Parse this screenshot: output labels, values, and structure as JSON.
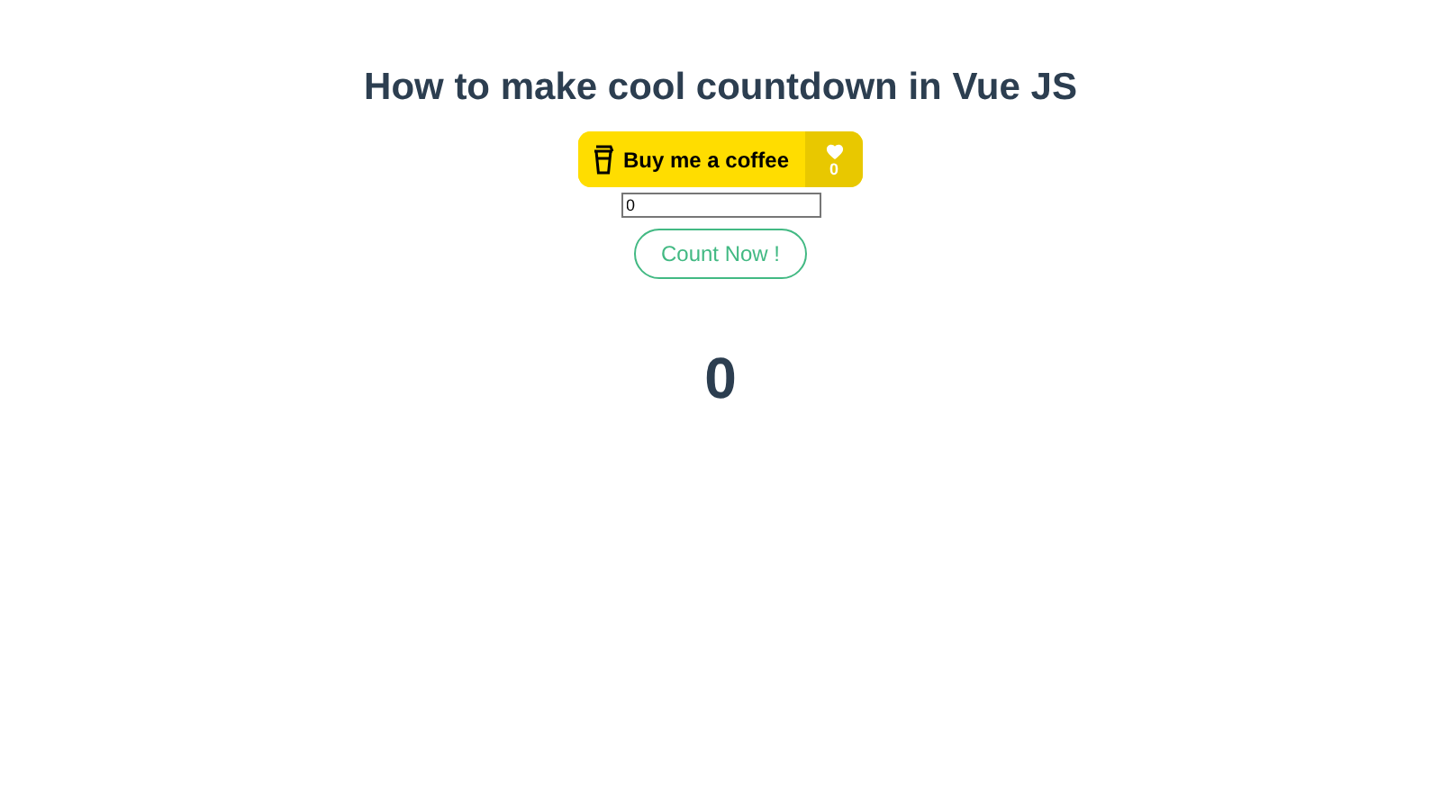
{
  "title": "How to make cool countdown in Vue JS",
  "coffee_button": {
    "label": "Buy me a coffee",
    "likes": "0"
  },
  "count_field": {
    "value": "0"
  },
  "count_button": {
    "label": "Count Now !"
  },
  "counter": "0"
}
